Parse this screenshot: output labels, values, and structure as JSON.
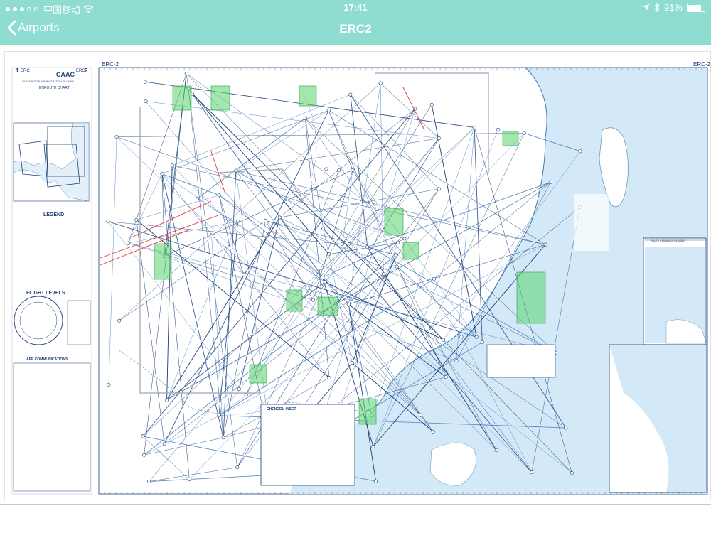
{
  "status_bar": {
    "carrier": "中国移动",
    "time": "17:41",
    "battery_percent": "91%",
    "battery_level": 0.91,
    "signal_bars_filled": 3,
    "signal_bars_total": 5
  },
  "nav": {
    "back_label": "Airports",
    "title": "ERC2"
  },
  "chart": {
    "sheet_id_left": "ERC-2",
    "sheet_id_right": "ERC-2",
    "panel_header_left": "ERC",
    "panel_header_right": "ERC",
    "panel_header_num_left": "1",
    "panel_header_num_right": "2",
    "brand": "CAAC",
    "agency": "CIVIL AVIATION ADMINISTRATION OF CHINA",
    "chart_name": "ENROUTE CHART",
    "legend_title": "LEGEND",
    "flight_levels_title": "FLIGHT LEVELS",
    "app_comm_title": "APP COMMUNICATIONS",
    "inset_title": "CHENGDU INSET",
    "inset_sea_title": "SOUTH CHINA SEA ISLANDS"
  },
  "colors": {
    "accent": "#8fdcd0",
    "route": "#1b3e78",
    "water": "#d3e9f7",
    "restricted": "#e53935",
    "area_green": "#58d36e"
  }
}
